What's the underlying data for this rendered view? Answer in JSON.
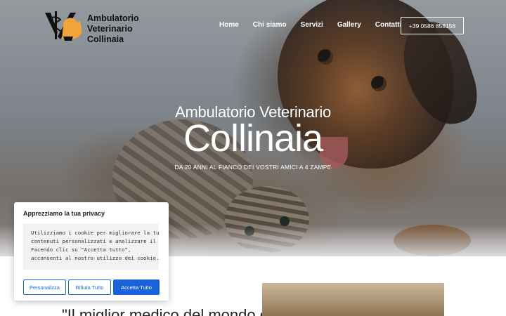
{
  "header": {
    "logo_lines": [
      "Ambulatorio",
      "Veterinario",
      "Collinaia"
    ],
    "nav": [
      "Home",
      "Chi siamo",
      "Servizi",
      "Gallery",
      "Contatti"
    ],
    "phone": "+39 0586 858158"
  },
  "hero": {
    "subtitle": "Ambulatorio Veterinario",
    "title": "Collinaia",
    "tagline": "DA 20 ANNI AL FIANCO DEI VOSTRI AMICI A 4 ZAMPE"
  },
  "content": {
    "quote_start": "\"Il miglior medico del mondo è"
  },
  "cookie": {
    "title": "Apprezziamo la tua privacy",
    "lines": [
      "Utilizziamo i cookie per migliorare la tua e",
      " contenuti personalizzati e analizzare il n",
      "Facendo clic su \"Accetta tutto\",",
      "acconsenti al nostro utilizzo dei cookie."
    ],
    "buttons": {
      "customize": "Personalizza",
      "reject": "Rifiuta Tutto",
      "accept": "Accetta Tutto"
    }
  },
  "colors": {
    "accent": "#1863dc",
    "logo_orange": "#f2a33a"
  }
}
